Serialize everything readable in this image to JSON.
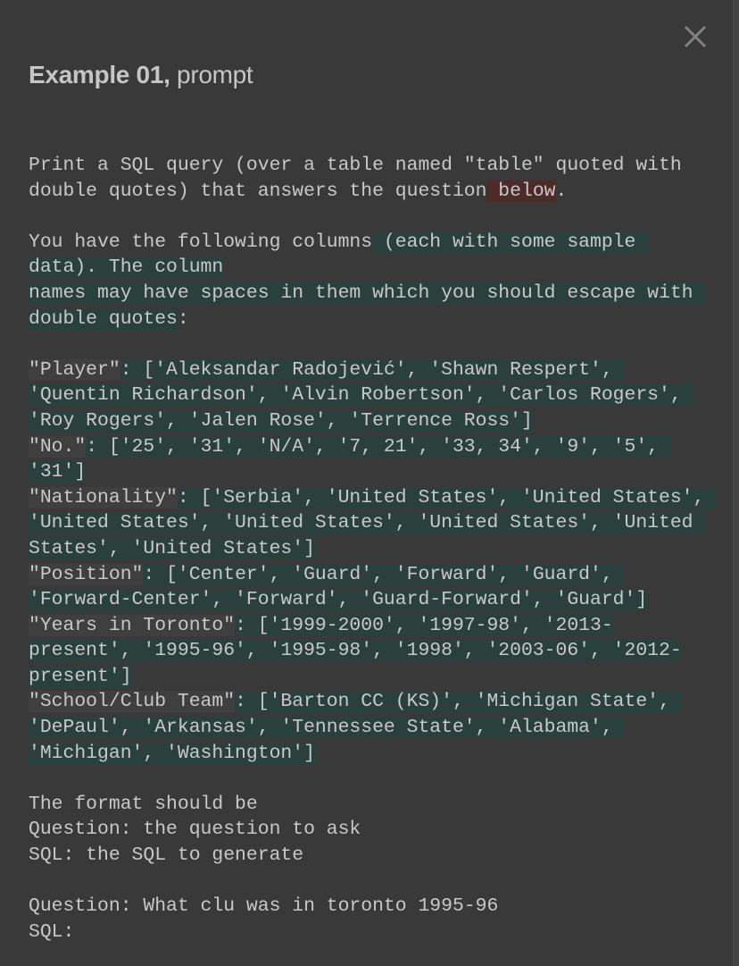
{
  "dialog": {
    "title_bold": "Example 01,",
    "title_rest": " prompt",
    "close_icon": "close-icon"
  },
  "colors": {
    "background": "#393939",
    "text": "#c8c8c8",
    "highlight_green": "#2a403c",
    "highlight_red": "#4d2b29",
    "highlight_column": "#3f3f3f",
    "close_icon": "#7d8582"
  },
  "prompt": {
    "lines": [
      [
        {
          "t": "Print a SQL query (over a table named \"table\" quoted with",
          "h": ""
        }
      ],
      [
        {
          "t": "double quotes) that answers the question",
          "h": ""
        },
        {
          "t": " below",
          "h": "red"
        },
        {
          "t": ".",
          "h": ""
        }
      ],
      [],
      [
        {
          "t": "You have the following columns",
          "h": ""
        },
        {
          "t": " (each with some sample ",
          "h": "green"
        }
      ],
      [
        {
          "t": "data). The column",
          "h": "green"
        }
      ],
      [
        {
          "t": "names may have spaces in them which you should escape with ",
          "h": "green"
        }
      ],
      [
        {
          "t": "double quotes",
          "h": "green"
        },
        {
          "t": ":",
          "h": ""
        }
      ],
      [],
      [
        {
          "t": "\"Player\"",
          "h": "col"
        },
        {
          "t": ": ['Aleksandar Radojević', 'Shawn Respert', ",
          "h": "green"
        }
      ],
      [
        {
          "t": "'Quentin Richardson', 'Alvin Robertson', 'Carlos Rogers', ",
          "h": "green"
        }
      ],
      [
        {
          "t": "'Roy Rogers', 'Jalen Rose', 'Terrence Ross']",
          "h": "green"
        }
      ],
      [
        {
          "t": "\"No.\"",
          "h": "col"
        },
        {
          "t": ": ['25', '31', 'N/A', '7, 21', '33, 34', '9', '5', ",
          "h": "green"
        }
      ],
      [
        {
          "t": "'31']",
          "h": "green"
        }
      ],
      [
        {
          "t": "\"Nationality\"",
          "h": "col"
        },
        {
          "t": ": ['Serbia', 'United States', 'United States', ",
          "h": "green"
        }
      ],
      [
        {
          "t": "'United States', 'United States', 'United States', 'United ",
          "h": "green"
        }
      ],
      [
        {
          "t": "States', 'United States']",
          "h": "green"
        }
      ],
      [
        {
          "t": "\"Position\"",
          "h": "col"
        },
        {
          "t": ": ['Center', 'Guard', 'Forward', 'Guard', ",
          "h": "green"
        }
      ],
      [
        {
          "t": "'Forward-Center', 'Forward', 'Guard-Forward', 'Guard']",
          "h": "green"
        }
      ],
      [
        {
          "t": "\"Years in Toronto\"",
          "h": "col"
        },
        {
          "t": ": ['1999-2000', '1997-98', '2013-",
          "h": "green"
        }
      ],
      [
        {
          "t": "present', '1995-96', '1995-98', '1998', '2003-06', '2012-",
          "h": "green"
        }
      ],
      [
        {
          "t": "present']",
          "h": "green"
        }
      ],
      [
        {
          "t": "\"School/Club Team\"",
          "h": "col"
        },
        {
          "t": ": ['Barton CC (KS)', 'Michigan State', ",
          "h": "green"
        }
      ],
      [
        {
          "t": "'DePaul', 'Arkansas', 'Tennessee State', 'Alabama', ",
          "h": "green"
        }
      ],
      [
        {
          "t": "'Michigan', 'Washington']",
          "h": "green"
        }
      ],
      [],
      [
        {
          "t": "The format should be",
          "h": ""
        }
      ],
      [
        {
          "t": "Question: the question to ask",
          "h": ""
        }
      ],
      [
        {
          "t": "SQL: the SQL to generate",
          "h": ""
        }
      ],
      [],
      [
        {
          "t": "Question: What clu was in toronto 1995-96",
          "h": ""
        }
      ],
      [
        {
          "t": "SQL:",
          "h": ""
        }
      ]
    ]
  }
}
